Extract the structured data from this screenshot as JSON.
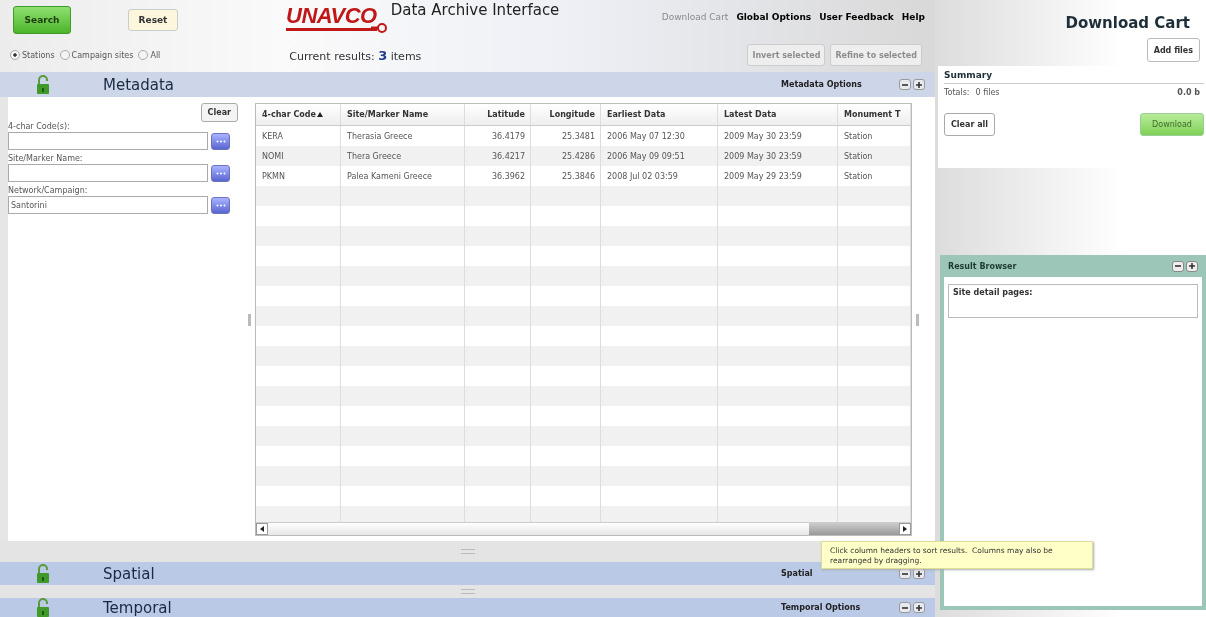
{
  "header": {
    "buttons": [
      {
        "label": "Search",
        "kind": "primary"
      },
      {
        "label": "Reset",
        "kind": "secondary"
      }
    ],
    "logo": {
      "text": "UNAVCO",
      "subtitle": "Data Archive Interface"
    },
    "links": [
      {
        "label": "Download Cart",
        "disabled": true
      },
      {
        "label": "Global Options",
        "disabled": false
      },
      {
        "label": "User Feedback",
        "disabled": false
      },
      {
        "label": "Help",
        "disabled": false
      }
    ],
    "site_types": [
      {
        "label": "Stations",
        "selected": true
      },
      {
        "label": "Campaign sites",
        "selected": false
      },
      {
        "label": "All",
        "selected": false
      }
    ],
    "results": {
      "prefix": "Current results:",
      "count": "3",
      "suffix": "items"
    },
    "actions": [
      {
        "label": "Invert selected",
        "disabled": true
      },
      {
        "label": "Refine to selected",
        "disabled": true
      }
    ]
  },
  "sections": [
    {
      "title": "Metadata",
      "options": "Metadata Options",
      "expanded": true
    },
    {
      "title": "Spatial",
      "options": "Spatial",
      "expanded": false
    },
    {
      "title": "Temporal",
      "options": "Temporal Options",
      "expanded": false
    }
  ],
  "metadata": {
    "clear": "Clear",
    "fields": [
      {
        "label": "4-char Code(s):"
      },
      {
        "label": "Site/Marker Name:"
      },
      {
        "label": "Network/Campaign:",
        "value": "Santorini"
      }
    ]
  },
  "table": {
    "columns": [
      {
        "label": "4-char Code",
        "sorted": true
      },
      {
        "label": "Site/Marker Name",
        "sorted": false
      },
      {
        "label": "Latitude",
        "sorted": false
      },
      {
        "label": "Longitude",
        "sorted": false
      },
      {
        "label": "Earliest Data",
        "sorted": false
      },
      {
        "label": "Latest Data",
        "sorted": false
      },
      {
        "label": "Monument T",
        "sorted": false
      }
    ],
    "rows": [
      [
        "KERA",
        "Therasia Greece",
        "36.4179",
        "25.3481",
        "2006 May 07 12:30",
        "2009 May 30 23:59",
        "Station"
      ],
      [
        "NOMI",
        "Thera Greece",
        "36.4217",
        "25.4286",
        "2006 May 09 09:51",
        "2009 May 30 23:59",
        "Station"
      ],
      [
        "PKMN",
        "Palea Kameni Greece",
        "36.3962",
        "25.3846",
        "2008 Jul 02 03:59",
        "2009 May 29 23:59",
        "Station"
      ]
    ]
  },
  "cart": {
    "title": "Download Cart",
    "add_files": "Add files",
    "summary": {
      "title": "Summary",
      "totals_label": "Totals:",
      "files": "0 files",
      "size": "0.0 b"
    },
    "clear_all": "Clear all",
    "download": {
      "label": "Download",
      "disabled": true
    }
  },
  "result_browser": {
    "title": "Result Browser",
    "heading": "Site detail pages:"
  },
  "tooltip": "Click column headers to sort results.  Columns may also be rearranged by dragging."
}
